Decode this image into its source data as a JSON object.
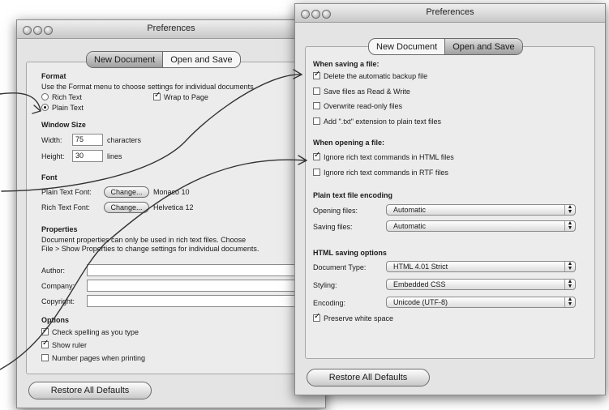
{
  "left_window": {
    "title": "Preferences",
    "tabs": [
      "New Document",
      "Open and Save"
    ],
    "format": {
      "heading": "Format",
      "description": "Use the Format menu to choose settings for individual documents.",
      "rich_text": "Rich Text",
      "plain_text": "Plain Text",
      "wrap_to_page": "Wrap to Page"
    },
    "window_size": {
      "heading": "Window Size",
      "width_label": "Width:",
      "width_value": "75",
      "width_unit": "characters",
      "height_label": "Height:",
      "height_value": "30",
      "height_unit": "lines"
    },
    "font": {
      "heading": "Font",
      "plain_label": "Plain Text Font:",
      "plain_value": "Monaco 10",
      "rich_label": "Rich Text Font:",
      "rich_value": "Helvetica 12",
      "change_label": "Change..."
    },
    "properties": {
      "heading": "Properties",
      "desc1": "Document properties can only be used in rich text files. Choose",
      "desc2": "File > Show Properties to change settings for individual documents.",
      "author": "Author:",
      "company": "Company:",
      "copyright": "Copyright:"
    },
    "options": {
      "heading": "Options",
      "check_spelling": "Check spelling as you type",
      "show_ruler": "Show ruler",
      "number_pages": "Number pages when printing"
    },
    "restore": "Restore All Defaults"
  },
  "right_window": {
    "title": "Preferences",
    "tabs": [
      "New Document",
      "Open and Save"
    ],
    "saving": {
      "heading": "When saving a file:",
      "delete_backup": "Delete the automatic backup file",
      "read_write": "Save files as Read & Write",
      "overwrite": "Overwrite read-only files",
      "add_txt": "Add \".txt\" extension to plain text files"
    },
    "opening": {
      "heading": "When opening a file:",
      "ignore_html": "Ignore rich text commands in HTML files",
      "ignore_rtf": "Ignore rich text commands in RTF files"
    },
    "encoding": {
      "heading": "Plain text file encoding",
      "opening_label": "Opening files:",
      "opening_value": "Automatic",
      "saving_label": "Saving files:",
      "saving_value": "Automatic"
    },
    "html": {
      "heading": "HTML saving options",
      "doctype_label": "Document Type:",
      "doctype_value": "HTML 4.01 Strict",
      "styling_label": "Styling:",
      "styling_value": "Embedded CSS",
      "encoding_label": "Encoding:",
      "encoding_value": "Unicode (UTF-8)",
      "preserve": "Preserve white space"
    },
    "restore": "Restore All Defaults"
  }
}
